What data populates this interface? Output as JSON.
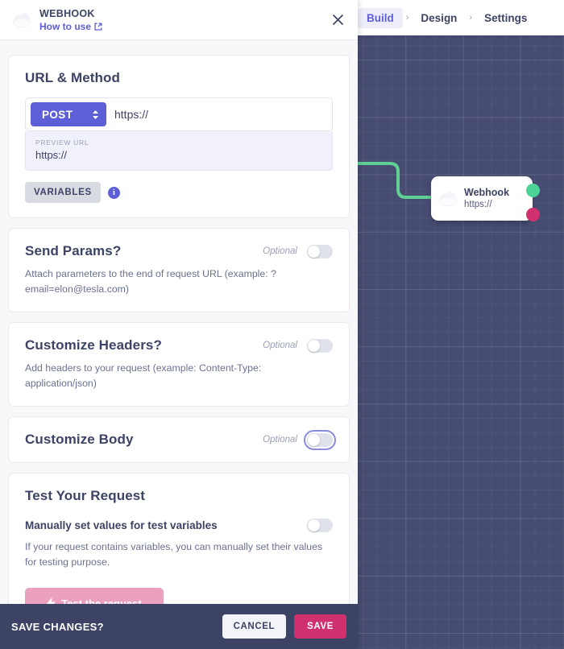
{
  "nav": {
    "items": [
      {
        "label": "Build",
        "active": true
      },
      {
        "label": "Design",
        "active": false
      },
      {
        "label": "Settings",
        "active": false
      }
    ],
    "separator": "›"
  },
  "panel": {
    "header": {
      "icon": "cloud-icon",
      "title": "WEBHOOK",
      "link": "How to use",
      "link_icon": "external-link-icon",
      "close_icon": "close-icon"
    },
    "url_method": {
      "title": "URL & Method",
      "method": "POST",
      "url_value": "https://",
      "preview_label": "PREVIEW URL",
      "preview_value": "https://",
      "variables_button": "VARIABLES",
      "info_icon": "info-icon"
    },
    "send_params": {
      "title": "Send Params?",
      "optional": "Optional",
      "description": "Attach parameters to the end of request URL (example: ?email=elon@tesla.com)",
      "toggle_on": false
    },
    "customize_headers": {
      "title": "Customize Headers?",
      "optional": "Optional",
      "description": "Add headers to your request (example: Content-Type: application/json)",
      "toggle_on": false
    },
    "customize_body": {
      "title": "Customize Body",
      "optional": "Optional",
      "toggle_on": false,
      "focused": true
    },
    "test_request": {
      "title": "Test Your Request",
      "subtitle": "Manually set values for test variables",
      "description": "If your request contains variables, you can manually set their values for testing purpose.",
      "toggle_on": false,
      "button_label": "Test the request",
      "button_icon": "bolt-icon"
    },
    "savebar": {
      "label": "SAVE CHANGES?",
      "cancel": "CANCEL",
      "save": "SAVE"
    }
  },
  "canvas": {
    "node": {
      "icon": "cloud-icon",
      "title": "Webhook",
      "subtitle": "https://",
      "output_success_dot": "#4cd397",
      "output_error_dot": "#d1306f"
    },
    "connector_color": "#5fcf93",
    "background_color": "#474c72"
  },
  "colors": {
    "accent_purple": "#5d5fd6",
    "accent_pink": "#d1306f",
    "dark_navy": "#3d4365",
    "green": "#4cd397"
  }
}
